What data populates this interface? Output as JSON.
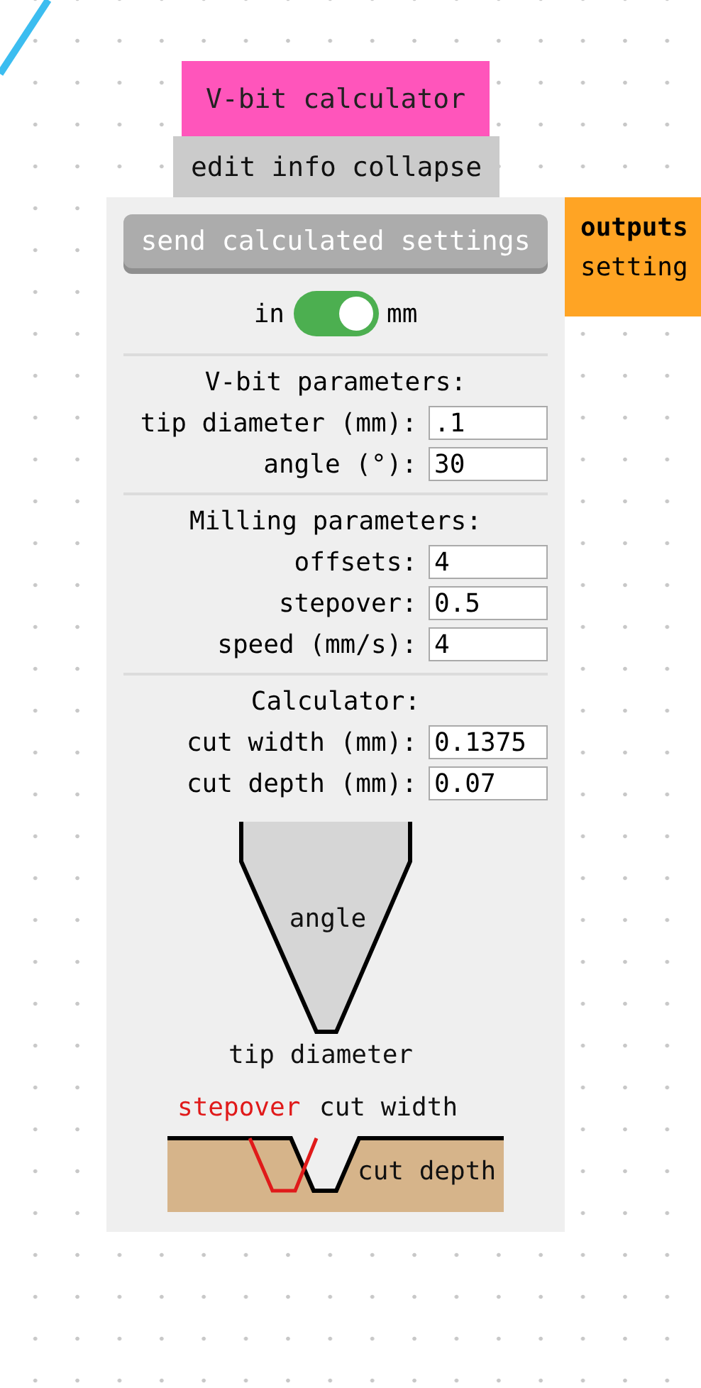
{
  "title": "V-bit calculator",
  "toolbar": [
    {
      "label": "edit"
    },
    {
      "label": "info"
    },
    {
      "label": "collapse"
    }
  ],
  "send_button": "send calculated settings",
  "unit_toggle": {
    "left": "in",
    "right": "mm",
    "on": true
  },
  "sections": [
    {
      "heading": "V-bit parameters:",
      "fields": [
        {
          "label": "tip diameter (mm):",
          "value": ".1"
        },
        {
          "label": "angle (°):",
          "value": "30"
        }
      ]
    },
    {
      "heading": "Milling parameters:",
      "fields": [
        {
          "label": "offsets:",
          "value": "4"
        },
        {
          "label": "stepover:",
          "value": "0.5"
        },
        {
          "label": "speed (mm/s):",
          "value": "4"
        }
      ]
    },
    {
      "heading": "Calculator:",
      "fields": [
        {
          "label": "cut width (mm):",
          "value": "0.1375"
        },
        {
          "label": "cut depth (mm):",
          "value": "0.07"
        }
      ]
    }
  ],
  "diagram": {
    "angle_label": "angle",
    "tip_label": "tip diameter",
    "stepover_label": "stepover",
    "cut_width_label": "cut width",
    "cut_depth_label": "cut depth"
  },
  "outputs": {
    "heading": "outputs",
    "items": [
      "setting"
    ]
  }
}
